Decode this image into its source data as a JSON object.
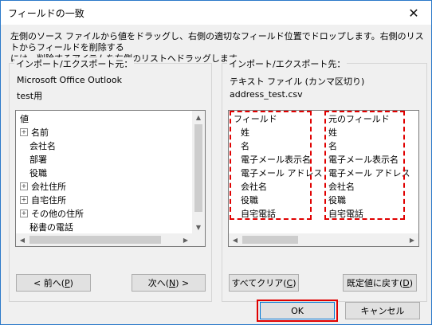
{
  "window": {
    "title": "フィールドの一致",
    "close_glyph": "✕"
  },
  "instructions": {
    "line1": "左側のソース ファイルから値をドラッグし、右側の適切なフィールド位置でドロップします。右側のリストからフィールドを削除する",
    "line2": "には、削除するアイテムを左側のリストへドラッグします。"
  },
  "left_group": {
    "label": "インポート/エクスポート元：",
    "source": "Microsoft Office Outlook",
    "folder": "test用",
    "header": "値",
    "items": [
      {
        "label": "名前",
        "expandable": true
      },
      {
        "label": "会社名",
        "expandable": false
      },
      {
        "label": "部署",
        "expandable": false
      },
      {
        "label": "役職",
        "expandable": false
      },
      {
        "label": "会社住所",
        "expandable": true
      },
      {
        "label": "自宅住所",
        "expandable": true
      },
      {
        "label": "その他の住所",
        "expandable": true
      },
      {
        "label": "秘書の電話",
        "expandable": false
      }
    ],
    "prev_button": {
      "label": "< 前へ(",
      "key": "P",
      "suffix": ")"
    },
    "next_button": {
      "label": "次へ(",
      "key": "N",
      "suffix": ") >"
    }
  },
  "right_group": {
    "label": "インポート/エクスポート先：",
    "target": "テキスト ファイル (カンマ区切り)",
    "file": "address_test.csv",
    "col1_header": "フィールド",
    "col2_header": "元のフィールド",
    "rows": [
      {
        "field": "姓",
        "source": "姓"
      },
      {
        "field": "名",
        "source": "名"
      },
      {
        "field": "電子メール表示名",
        "source": "電子メール表示名"
      },
      {
        "field": "電子メール アドレス",
        "source": "電子メール アドレス"
      },
      {
        "field": "会社名",
        "source": "会社名"
      },
      {
        "field": "役職",
        "source": "役職"
      },
      {
        "field": "自宅電話",
        "source": "自宅電話"
      }
    ],
    "clear_button": {
      "label": "すべてクリア(",
      "key": "C",
      "suffix": ")"
    },
    "default_button": {
      "label": "既定値に戻す(",
      "key": "D",
      "suffix": ")"
    }
  },
  "footer": {
    "ok_label": "OK",
    "cancel_label": "キャンセル"
  },
  "colors": {
    "accent": "#0078d7",
    "highlight": "#e00000",
    "border": "#2b79c9"
  }
}
